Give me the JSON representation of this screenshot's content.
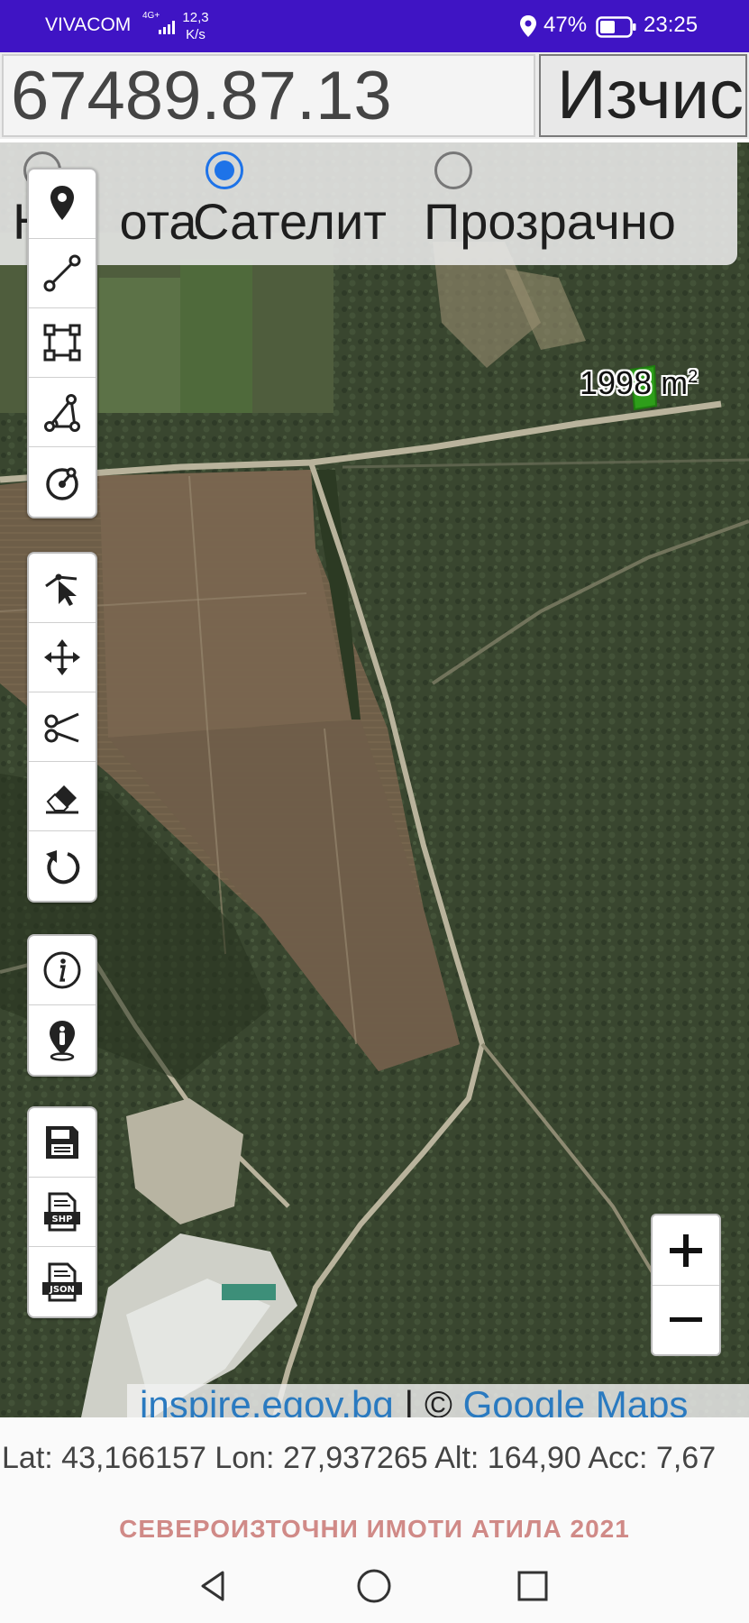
{
  "status_bar": {
    "carrier": "VIVACOM",
    "network": "4G+",
    "speed_value": "12,3",
    "speed_unit": "K/s",
    "battery": "47%",
    "time": "23:25"
  },
  "coordinate_input": {
    "value": "67489.87.13"
  },
  "calculate_button": {
    "label": "Изчис"
  },
  "layers": {
    "options": [
      {
        "label": "Карта",
        "visible_label": "Н",
        "visible_suffix": "ота",
        "checked": false
      },
      {
        "label": "Сателит",
        "checked": true
      },
      {
        "label": "Прозрачно",
        "checked": false
      }
    ]
  },
  "toolbar_groups": [
    [
      "location-pin-icon",
      "line-measure-icon",
      "polygon-area-icon",
      "angle-measure-icon",
      "circle-icon"
    ],
    [
      "select-pointer-icon",
      "move-icon",
      "cut-icon",
      "eraser-icon",
      "undo-icon"
    ],
    [
      "info-icon",
      "person-location-icon"
    ],
    [
      "save-icon",
      "shp-export-icon",
      "json-export-icon"
    ]
  ],
  "toolbar_text": {
    "shp": "SHP",
    "json": "JSON"
  },
  "area_label": {
    "value": "1998 m",
    "sup": "2"
  },
  "zoom": {
    "plus": "+",
    "minus": "−"
  },
  "attribution": {
    "source": "inspire.egov.bg",
    "separator": " | © ",
    "provider": "Google Maps"
  },
  "gps": {
    "text": "Lat: 43,166157 Lon: 27,937265 Alt: 164,90 Acc: 7,67"
  },
  "footer": {
    "brand": "СЕВЕРОИЗТОЧНИ ИМОТИ АТИЛА 2021"
  },
  "colors": {
    "status_bar": "#3f14c4",
    "accent": "#1e73e8",
    "link": "#2a7ac0",
    "brand": "#d08a87",
    "parcel": "#2e9e1a"
  }
}
